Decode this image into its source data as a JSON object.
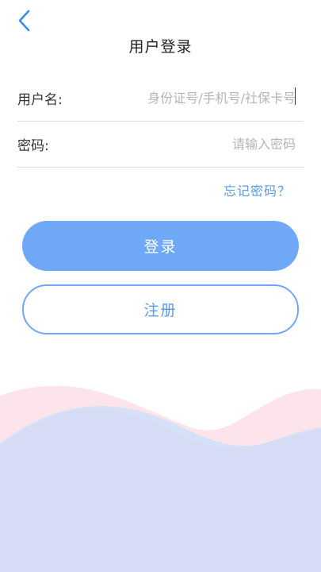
{
  "header": {
    "title": "用户登录"
  },
  "form": {
    "username": {
      "label": "用户名:",
      "placeholder": "身份证号/手机号/社保卡号",
      "value": ""
    },
    "password": {
      "label": "密码:",
      "placeholder": "请输入密码",
      "value": ""
    }
  },
  "links": {
    "forgot_password": "忘记密码？"
  },
  "buttons": {
    "login": "登录",
    "register": "注册"
  },
  "icons": {
    "back": "chevron-left-icon"
  },
  "colors": {
    "accent": "#6ea8f7",
    "link": "#5a9be6",
    "wave_pink": "#fde4ea",
    "wave_blue": "#cfe0fa",
    "wave_lavender": "#d6dbf4"
  }
}
